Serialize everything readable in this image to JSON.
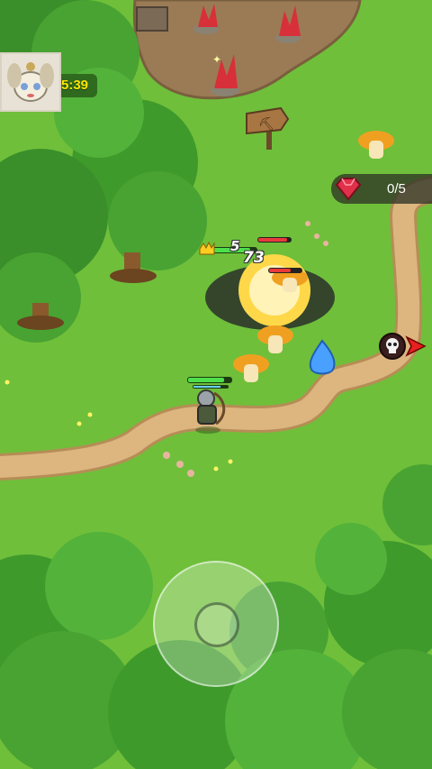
{
  "hud": {
    "timer": "5:39",
    "gem_counter": "0/5",
    "portrait_icon": "character-portrait-icon",
    "gem_icon": "red-gem-icon"
  },
  "combat": {
    "damage_numbers": [
      "5",
      "73"
    ],
    "boss_icon": "skull-marker-icon",
    "direction_icon": "red-arrow-icon"
  },
  "colors": {
    "grass": "#6fbf3a",
    "path": "#d8b07a",
    "tree": "#3f9a2c",
    "timer": "#ffe400",
    "gem": "#e0304a",
    "health": "#4ee04a"
  }
}
